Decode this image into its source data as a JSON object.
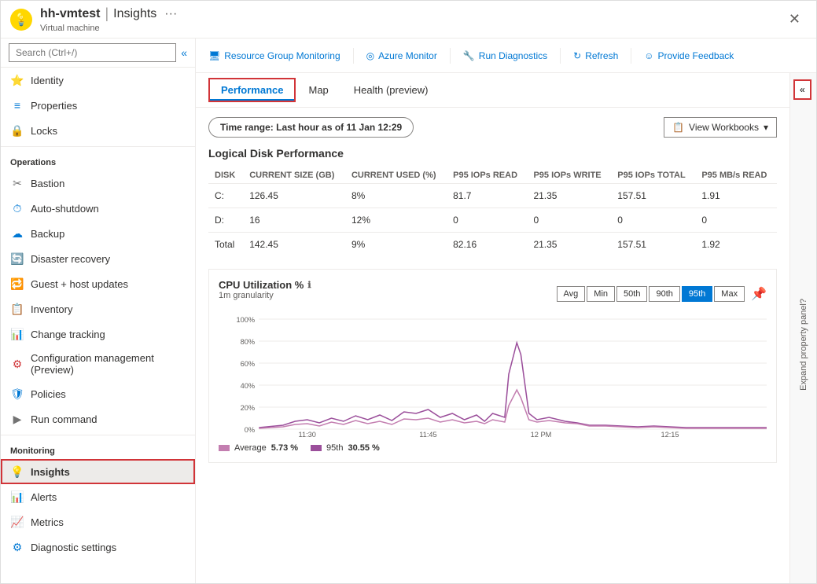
{
  "header": {
    "icon": "💡",
    "vm_name": "hh-vmtest",
    "separator": "|",
    "page_name": "Insights",
    "subtitle": "Virtual machine",
    "dots": "···",
    "close": "✕"
  },
  "toolbar": {
    "items": [
      {
        "id": "resource-group-monitoring",
        "icon": "🖥",
        "label": "Resource Group Monitoring"
      },
      {
        "id": "azure-monitor",
        "icon": "◎",
        "label": "Azure Monitor"
      },
      {
        "id": "run-diagnostics",
        "icon": "🔧",
        "label": "Run Diagnostics"
      },
      {
        "id": "refresh",
        "icon": "↻",
        "label": "Refresh"
      },
      {
        "id": "provide-feedback",
        "icon": "☺",
        "label": "Provide Feedback"
      }
    ]
  },
  "sidebar": {
    "search_placeholder": "Search (Ctrl+/)",
    "collapse_label": "«",
    "items_above": [
      {
        "id": "identity",
        "icon": "⭐",
        "label": "Identity",
        "color": "identity"
      },
      {
        "id": "properties",
        "icon": "≡",
        "label": "Properties",
        "color": "shutdown"
      },
      {
        "id": "locks",
        "icon": "🔒",
        "label": "Locks",
        "color": "shutdown"
      }
    ],
    "operations_label": "Operations",
    "operations_items": [
      {
        "id": "bastion",
        "icon": "✂",
        "label": "Bastion",
        "color": "bastion"
      },
      {
        "id": "auto-shutdown",
        "icon": "⏱",
        "label": "Auto-shutdown",
        "color": "shutdown"
      },
      {
        "id": "backup",
        "icon": "☁",
        "label": "Backup",
        "color": "backup"
      },
      {
        "id": "disaster-recovery",
        "icon": "🔄",
        "label": "Disaster recovery",
        "color": "disaster"
      },
      {
        "id": "guest-host-updates",
        "icon": "🔁",
        "label": "Guest + host updates",
        "color": "guest"
      },
      {
        "id": "inventory",
        "icon": "📋",
        "label": "Inventory",
        "color": "inventory"
      },
      {
        "id": "change-tracking",
        "icon": "📊",
        "label": "Change tracking",
        "color": "change"
      },
      {
        "id": "configuration-management",
        "icon": "⚙",
        "label": "Configuration management (Preview)",
        "color": "config"
      },
      {
        "id": "policies",
        "icon": "🛡",
        "label": "Policies",
        "color": "policies"
      },
      {
        "id": "run-command",
        "icon": "▶",
        "label": "Run command",
        "color": "run"
      }
    ],
    "monitoring_label": "Monitoring",
    "monitoring_items": [
      {
        "id": "insights",
        "icon": "💡",
        "label": "Insights",
        "active": true,
        "color": "insights"
      },
      {
        "id": "alerts",
        "icon": "📊",
        "label": "Alerts",
        "color": "alerts"
      },
      {
        "id": "metrics",
        "icon": "📈",
        "label": "Metrics",
        "color": "metrics"
      },
      {
        "id": "diagnostic-settings",
        "icon": "⚙",
        "label": "Diagnostic settings",
        "color": "diag"
      }
    ]
  },
  "tabs": [
    {
      "id": "performance",
      "label": "Performance",
      "active": true,
      "bordered": true
    },
    {
      "id": "map",
      "label": "Map",
      "active": false
    },
    {
      "id": "health",
      "label": "Health (preview)",
      "active": false
    }
  ],
  "time_range": {
    "prefix": "Time range:",
    "value": "Last hour as of 11 Jan 12:29"
  },
  "view_workbooks": {
    "icon": "📋",
    "label": "View Workbooks",
    "chevron": "▾"
  },
  "disk_performance": {
    "title": "Logical Disk Performance",
    "columns": [
      "DISK",
      "CURRENT SIZE (GB)",
      "CURRENT USED (%)",
      "P95 IOPs READ",
      "P95 IOPs WRITE",
      "P95 IOPs TOTAL",
      "P95 MB/s READ"
    ],
    "rows": [
      {
        "disk": "C:",
        "size": "126.45",
        "used": "8%",
        "read": "81.7",
        "write": "21.35",
        "total": "157.51",
        "mb_read": "1.91"
      },
      {
        "disk": "D:",
        "size": "16",
        "used": "12%",
        "read": "0",
        "write": "0",
        "total": "0",
        "mb_read": "0"
      },
      {
        "disk": "Total",
        "size": "142.45",
        "used": "9%",
        "read": "82.16",
        "write": "21.35",
        "total": "157.51",
        "mb_read": "1.92"
      }
    ]
  },
  "cpu_chart": {
    "title": "CPU Utilization %",
    "info": "ℹ",
    "granularity": "1m granularity",
    "buttons": [
      "Avg",
      "Min",
      "50th",
      "90th",
      "95th",
      "Max"
    ],
    "active_button": "95th",
    "y_labels": [
      "100%",
      "80%",
      "60%",
      "40%",
      "20%",
      "0%"
    ],
    "x_labels": [
      "11:30",
      "11:45",
      "12 PM",
      "12:15"
    ],
    "legend": [
      {
        "label": "Average",
        "value": "5.73 %",
        "color": "#c37eb0"
      },
      {
        "label": "95th",
        "value": "30.55 %",
        "color": "#9b4f9b"
      }
    ]
  },
  "expand_panel": {
    "label": "Expand property panel?",
    "button_icon": "«"
  }
}
